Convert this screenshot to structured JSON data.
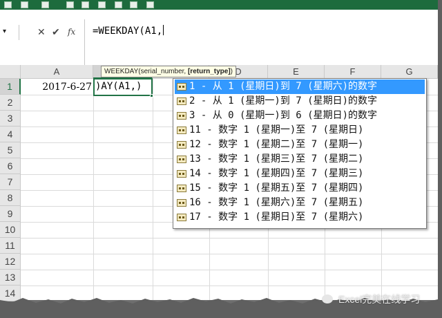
{
  "formula_bar": {
    "text": "=WEEKDAY(A1,",
    "cancel_icon": "✕",
    "enter_icon": "✔",
    "fx_label": "fx",
    "namebox_arrow": "▾"
  },
  "tooltip": {
    "prefix": "WEEKDAY(serial_number, ",
    "bold": "[return_type]",
    "suffix": ")"
  },
  "columns": [
    "A",
    "B",
    "C",
    "D",
    "E",
    "F",
    "G"
  ],
  "rows": [
    "1",
    "2",
    "3",
    "4",
    "5",
    "6",
    "7",
    "8",
    "9",
    "10",
    "11",
    "12",
    "13",
    "14"
  ],
  "cells": {
    "A1": "2017-6-27",
    "B1": ")AY(A1,)"
  },
  "autocomplete": {
    "selected_index": 0,
    "items": [
      "1 - 从 1 (星期日)到 7 (星期六)的数字",
      "2 - 从 1 (星期一)到 7 (星期日)的数字",
      "3 - 从 0 (星期一)到 6 (星期日)的数字",
      "11 - 数字 1 (星期一)至 7 (星期日)",
      "12 - 数字 1 (星期二)至 7 (星期一)",
      "13 - 数字 1 (星期三)至 7 (星期二)",
      "14 - 数字 1 (星期四)至 7 (星期三)",
      "15 - 数字 1 (星期五)至 7 (星期四)",
      "16 - 数字 1 (星期六)至 7 (星期五)",
      "17 - 数字 1 (星期日)至 7 (星期六)"
    ]
  },
  "watermark": "Excel完美在线学习",
  "colors": {
    "selection": "#217346",
    "highlight": "#3399ff",
    "tooltip_bg": "#ffffe6"
  }
}
